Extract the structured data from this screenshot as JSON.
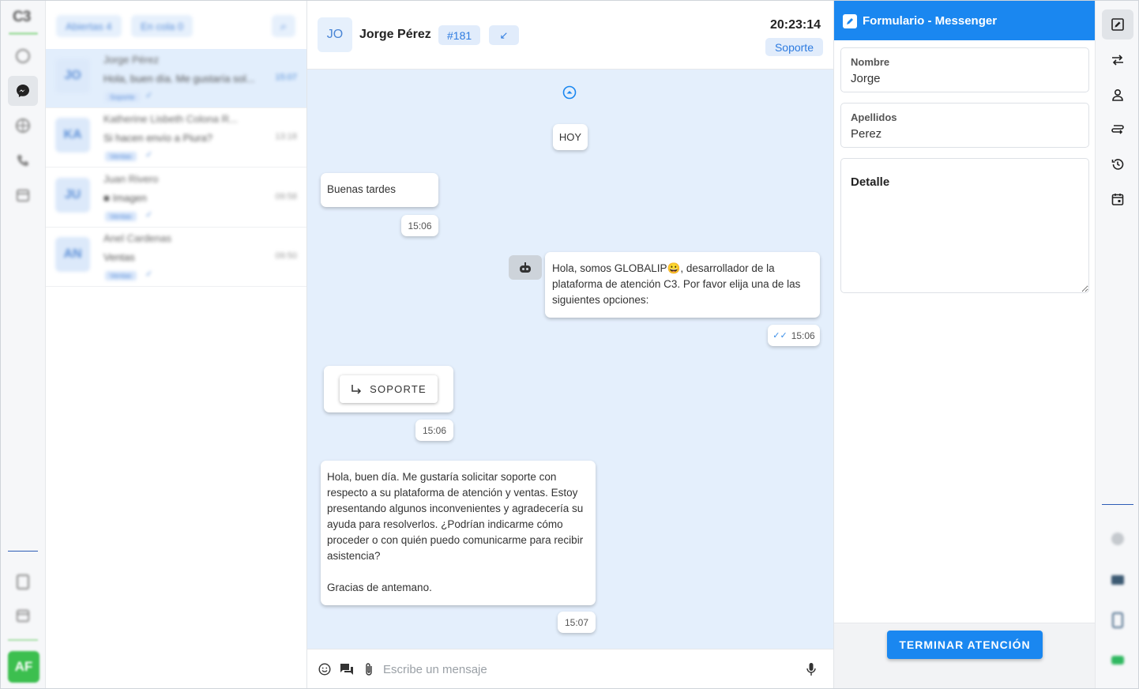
{
  "rail": {
    "logo": "C3",
    "items": [
      {
        "icon": "whatsapp-icon"
      },
      {
        "icon": "messenger-icon",
        "active": true
      },
      {
        "icon": "globe-icon"
      },
      {
        "icon": "phone-icon"
      },
      {
        "icon": "calendar-icon"
      }
    ],
    "bottom_items": [
      {
        "icon": "clipboard-icon"
      },
      {
        "icon": "calendar-icon"
      }
    ],
    "user_initials": "AF"
  },
  "list": {
    "filters": [
      "Abiertas 4",
      "En cola 0"
    ],
    "conversations": [
      {
        "initials": "JO",
        "name": "Jorge Pérez",
        "preview": "Hola, buen día. Me gustaría sol...",
        "time": "15:07",
        "tag": "Soporte",
        "selected": true
      },
      {
        "initials": "KA",
        "name": "Katherine Lisbeth Colona R...",
        "preview": "Si hacen envío a Piura?",
        "time": "13:18",
        "tag": "Ventas"
      },
      {
        "initials": "JU",
        "name": "Juan Rivero",
        "preview": "Imagen",
        "time": "09:58",
        "tag": "Ventas"
      },
      {
        "initials": "AN",
        "name": "Anel Cardenas",
        "preview": "Ventas",
        "time": "09:50",
        "tag": "Ventas"
      }
    ]
  },
  "chat": {
    "contact_initials": "JO",
    "contact_name": "Jorge Pérez",
    "ticket": "#181",
    "direction": "↙",
    "clock": "20:23:14",
    "queue": "Soporte",
    "day_label": "HOY",
    "messages": {
      "m1": {
        "text": "Buenas tardes",
        "time": "15:06"
      },
      "m2": {
        "text_a": "Hola, somos GLOBALIP",
        "emoji": "😀",
        "text_b": ", desarrollador de la plataforma de atención C3. Por favor elija una de las siguientes opciones:",
        "time": "15:06"
      },
      "m3": {
        "option": "SOPORTE",
        "time": "15:06"
      },
      "m4": {
        "text": "Hola, buen día. Me gustaría solicitar soporte con respecto a su plataforma de atención y ventas. Estoy presentando algunos inconvenientes y agradecería su ayuda para resolverlos. ¿Podrían indicarme cómo proceder o con quién puedo comunicarme para recibir asistencia?\n\nGracias de antemano.",
        "time": "15:07"
      }
    },
    "composer_placeholder": "Escribe un mensaje"
  },
  "form": {
    "title": "Formulario - Messenger",
    "fields": {
      "nombre": {
        "label": "Nombre",
        "value": "Jorge"
      },
      "apellidos": {
        "label": "Apellidos",
        "value": "Perez"
      },
      "detalle": {
        "label": "Detalle",
        "value": ""
      }
    },
    "end_button": "TERMINAR ATENCIÓN"
  },
  "colors": {
    "accent": "#1a87f0",
    "chat_bg": "#e4effc",
    "success": "#3cbf4f"
  }
}
